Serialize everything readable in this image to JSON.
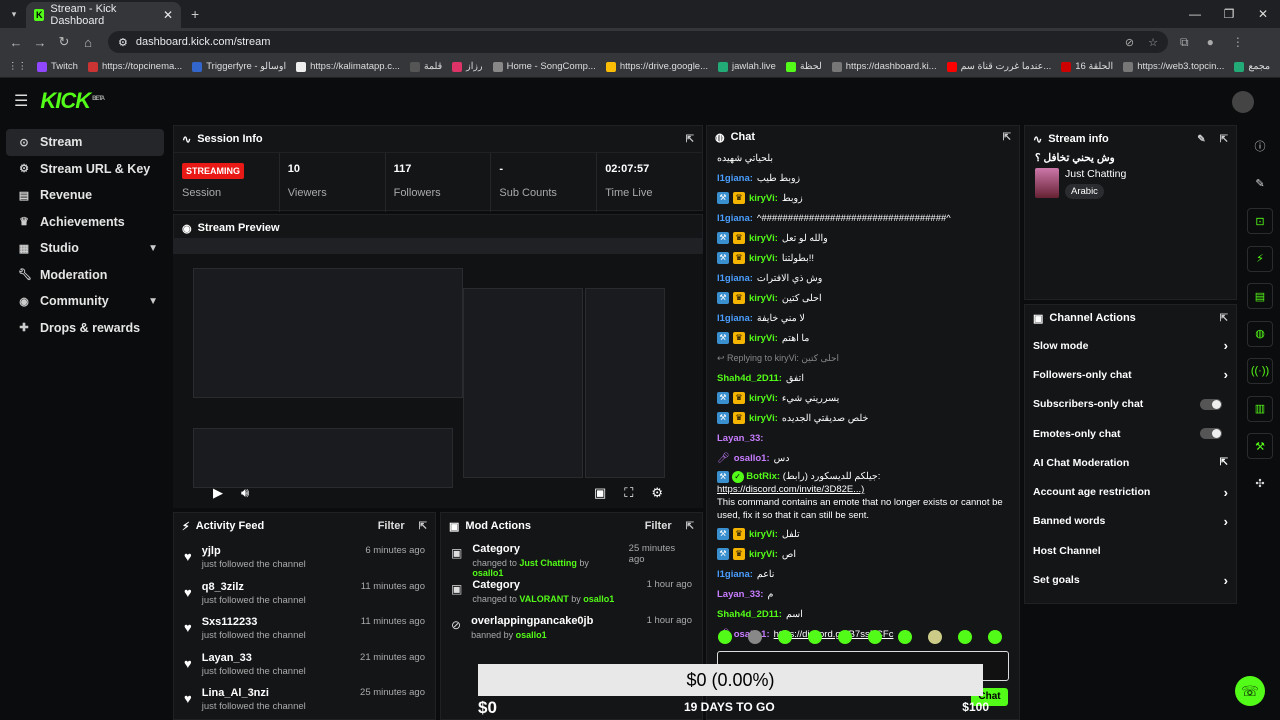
{
  "browser": {
    "tab_title": "Stream - Kick Dashboard",
    "url": "dashboard.kick.com/stream",
    "bookmarks": [
      "Twitch",
      "https://topcinema...",
      "Triggerfyre - اوسالو",
      "https://kalimatapp.c...",
      "قلمة",
      "رزاز",
      "Home - SongComp...",
      "https://drive.google...",
      "jawlah.live",
      "لحظة",
      "https://dashboard.ki...",
      "عندما غررت قناة سم...",
      "16 الحلقة",
      "https://web3.topcin...",
      "مجمع"
    ]
  },
  "sidebar": {
    "items": [
      {
        "label": "Stream",
        "icon": "stream-icon"
      },
      {
        "label": "Stream URL & Key",
        "icon": "key-icon"
      },
      {
        "label": "Revenue",
        "icon": "revenue-icon"
      },
      {
        "label": "Achievements",
        "icon": "trophy-icon"
      },
      {
        "label": "Studio",
        "icon": "studio-icon"
      },
      {
        "label": "Moderation",
        "icon": "wrench-icon"
      },
      {
        "label": "Community",
        "icon": "community-icon"
      },
      {
        "label": "Drops & rewards",
        "icon": "gift-icon"
      }
    ]
  },
  "session": {
    "title": "Session Info",
    "badge": "STREAMING",
    "stats": [
      {
        "label": "Session",
        "value": ""
      },
      {
        "label": "Viewers",
        "value": "10"
      },
      {
        "label": "Followers",
        "value": "117"
      },
      {
        "label": "Sub Counts",
        "value": "-"
      },
      {
        "label": "Time Live",
        "value": "02:07:57"
      }
    ]
  },
  "preview": {
    "title": "Stream Preview"
  },
  "activity": {
    "title": "Activity Feed",
    "filter": "Filter",
    "items": [
      {
        "name": "yjlp",
        "sub": "just followed the channel",
        "time": "6 minutes ago"
      },
      {
        "name": "q8_3zilz",
        "sub": "just followed the channel",
        "time": "11 minutes ago"
      },
      {
        "name": "Sxs112233",
        "sub": "just followed the channel",
        "time": "11 minutes ago"
      },
      {
        "name": "Layan_33",
        "sub": "just followed the channel",
        "time": "21 minutes ago"
      },
      {
        "name": "Lina_Al_3nzi",
        "sub": "just followed the channel",
        "time": "25 minutes ago"
      }
    ]
  },
  "mod": {
    "title": "Mod Actions",
    "filter": "Filter",
    "items": [
      {
        "name": "Category",
        "pre": "changed to ",
        "target": "Just Chatting",
        "mid": " by ",
        "by": "osallo1",
        "time": "25 minutes ago"
      },
      {
        "name": "Category",
        "pre": "changed to ",
        "target": "VALORANT",
        "mid": " by ",
        "by": "osallo1",
        "time": "1 hour ago"
      },
      {
        "name": "overlappingpancake0jb",
        "pre": "banned by ",
        "target": "",
        "mid": "",
        "by": "osallo1",
        "time": "1 hour ago"
      }
    ]
  },
  "chat": {
    "title": "Chat",
    "lines": [
      {
        "user": "",
        "text": "بلحياتي شهيده",
        "color": "blue"
      },
      {
        "user": "l1giana:",
        "text": "زوبط طيب",
        "color": "blue"
      },
      {
        "user": "kiryVi:",
        "text": "زوبط",
        "color": "green",
        "badges": true
      },
      {
        "user": "l1giana:",
        "text": "^###################################^",
        "color": "blue"
      },
      {
        "user": "kiryVi:",
        "text": "والله لو تعل",
        "color": "green",
        "badges": true
      },
      {
        "user": "kiryVi:",
        "text": "بطولتنا!!",
        "color": "green",
        "badges": true
      },
      {
        "user": "l1giana:",
        "text": "وش ذي الافترات",
        "color": "blue"
      },
      {
        "user": "kiryVi:",
        "text": "احلى كتين",
        "color": "green",
        "badges": true
      },
      {
        "user": "l1giana:",
        "text": "لا مني خايفة",
        "color": "blue"
      },
      {
        "user": "kiryVi:",
        "text": "ما اهتم",
        "color": "green",
        "badges": true
      },
      {
        "user": "",
        "text": "↩ Replying to kiryVi: احلى كتين",
        "color": "reply"
      },
      {
        "user": "Shah4d_2D11:",
        "text": "اتفق",
        "color": "green"
      },
      {
        "user": "kiryVi:",
        "text": "يسرريني شيء",
        "color": "green",
        "badges": true
      },
      {
        "user": "kiryVi:",
        "text": "خلص صديقتي الجديده",
        "color": "green",
        "badges": true
      },
      {
        "user": "Layan_33:",
        "text": "",
        "color": "purple"
      },
      {
        "user": "osallo1:",
        "text": "دس",
        "color": "purple",
        "mic": true
      }
    ],
    "bot": {
      "user": "BotRix:",
      "prefix": "جيلكم للديسكورد (رابط):",
      "link": "https://discord.com/invite/3D82E...)",
      "msg": "This command contains an emote that no longer exists or cannot be used, fix it so that it can still be sent."
    },
    "lines2": [
      {
        "user": "kiryVi:",
        "text": "تلفل",
        "color": "green",
        "badges": true
      },
      {
        "user": "kiryVi:",
        "text": "اص",
        "color": "green",
        "badges": true
      },
      {
        "user": "l1giana:",
        "text": "ناعم",
        "color": "blue"
      },
      {
        "user": "Layan_33:",
        "text": "م",
        "color": "purple"
      },
      {
        "user": "Shah4d_2D11:",
        "text": "اسم",
        "color": "green"
      }
    ],
    "last": {
      "user": "osallo1:",
      "link": "https://discord.gg/B7ssBCFc"
    },
    "send": "Chat"
  },
  "stream_info": {
    "title": "Stream info",
    "stream_title": "وش يحني تخافل ؟",
    "category": "Just Chatting",
    "language": "Arabic"
  },
  "channel_actions": {
    "title": "Channel Actions",
    "items": [
      {
        "label": "Slow mode",
        "ctl": "chevron"
      },
      {
        "label": "Followers-only chat",
        "ctl": "chevron"
      },
      {
        "label": "Subscribers-only chat",
        "ctl": "toggle"
      },
      {
        "label": "Emotes-only chat",
        "ctl": "toggle"
      },
      {
        "label": "AI Chat Moderation",
        "ctl": "external"
      },
      {
        "label": "Account age restriction",
        "ctl": "chevron"
      },
      {
        "label": "Banned words",
        "ctl": "chevron"
      },
      {
        "label": "Host Channel",
        "ctl": "none"
      },
      {
        "label": "Set goals",
        "ctl": "chevron"
      }
    ]
  },
  "goal": {
    "percent": "$0 (0.00%)",
    "current": "$0",
    "days": "19 DAYS TO GO",
    "target": "$100",
    "progress": 0
  }
}
